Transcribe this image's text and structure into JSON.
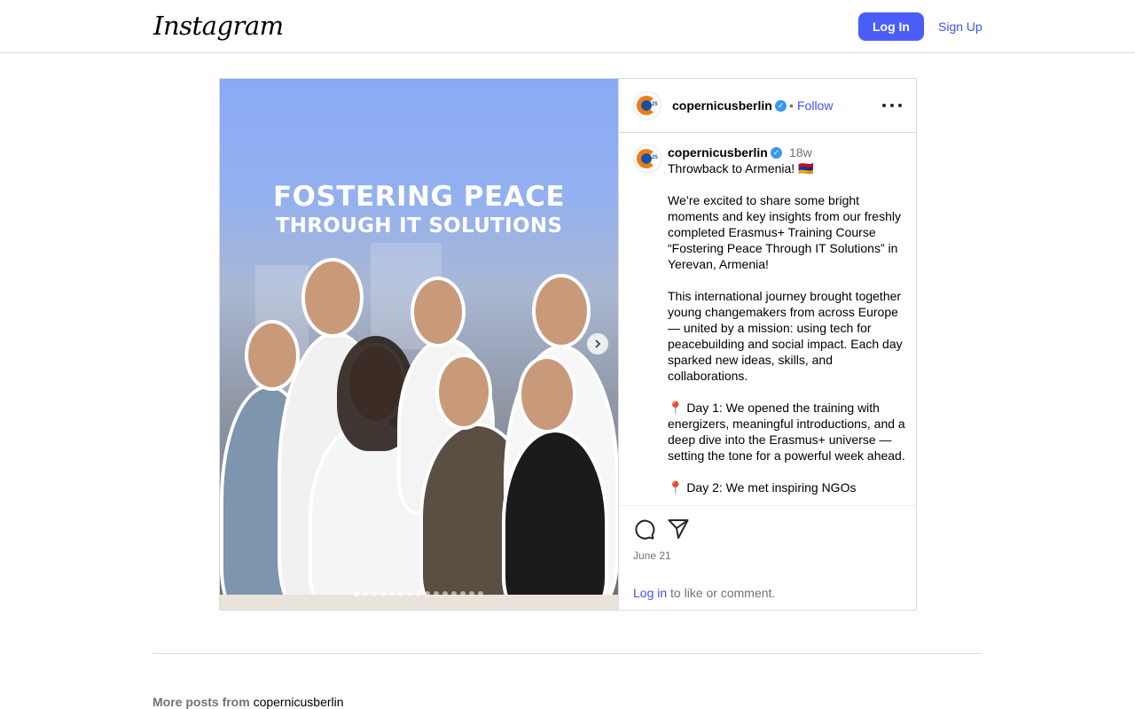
{
  "header": {
    "logo_text": "Instagram",
    "login_label": "Log In",
    "signup_label": "Sign Up"
  },
  "post": {
    "image": {
      "headline_line1": "FOSTERING PEACE",
      "headline_line2": "THROUGH IT SOLUTIONS",
      "carousel_count": 15,
      "carousel_active_index": 0
    },
    "author": {
      "username": "copernicusberlin",
      "avatar_badge": "25",
      "verified": true
    },
    "follow_separator": "•",
    "follow_label": "Follow",
    "time_ago": "18w",
    "caption": "Throwback to Armenia! 🇦🇲\n\nWe’re excited to share some bright moments and key insights from our freshly completed Erasmus+ Training Course “Fostering Peace Through IT Solutions” in Yerevan, Armenia!\n\nThis international journey brought together young changemakers from across Europe — united by a mission: using tech for peacebuilding and social impact. Each day sparked new ideas, skills, and collaborations.\n\n📍 Day 1: We opened the training with energizers, meaningful introductions, and a deep dive into the Erasmus+ universe — setting the tone for a powerful week ahead.\n\n📍 Day 2: We met inspiring NGOs",
    "date": "June 21",
    "login_prompt_link": "Log in",
    "login_prompt_text": " to like or comment."
  },
  "more_posts": {
    "label": "More posts from",
    "username": "copernicusberlin"
  },
  "colors": {
    "primary_button": "#4a5df9",
    "link": "#4150f7",
    "verified": "#3897f0"
  }
}
